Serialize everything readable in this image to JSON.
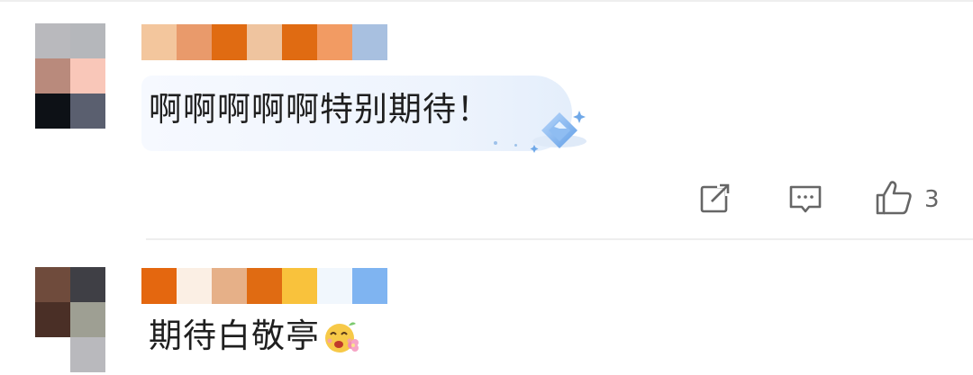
{
  "comments": [
    {
      "text": "啊啊啊啊啊特别期待！",
      "avatar_icon": "pixelated-avatar",
      "username_icon": "pixelated-username",
      "badge_icon": "diamond-badge-icon",
      "actions": {
        "share_icon": "share-icon",
        "reply_icon": "reply-icon",
        "like_icon": "thumbs-up-icon",
        "like_count": "3"
      }
    },
    {
      "text": "期待白敬亭",
      "emoji_icon": "flower-smile-emoji",
      "avatar_icon": "pixelated-avatar",
      "username_icon": "pixelated-username"
    }
  ],
  "colors": {
    "avatar1": [
      "#b9b9bd",
      "#b5b7bb",
      "#b98a7c",
      "#f9c7b9",
      "#0d1116",
      "#5a5f6f"
    ],
    "username1": [
      "#f3c69d",
      "#e99a6b",
      "#e06b12",
      "#efc49f",
      "#e06b12",
      "#f29b63",
      "#a8c0e0"
    ],
    "avatar2": [
      "#6f4b3c",
      "#3f3f45",
      "#4a2f26",
      "#9e9f93",
      "#ffffff",
      "#b9b9bd"
    ],
    "username2": [
      "#e4670f",
      "#fbefe4",
      "#e6b088",
      "#e06b12",
      "#f9c23c",
      "#f1f7fd",
      "#7fb4f1"
    ],
    "icon_gray": "#666666",
    "badge_blue": "#6fa8e8"
  }
}
